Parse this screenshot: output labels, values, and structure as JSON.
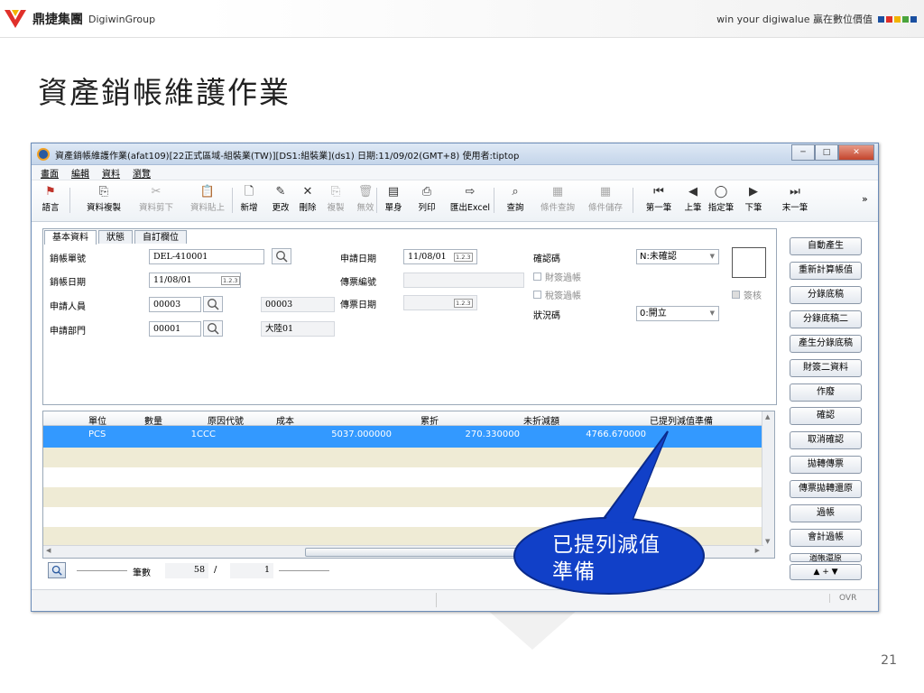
{
  "header": {
    "logo_cn": "鼎捷集團",
    "logo_en": "DigiwinGroup",
    "slogan": "win your digiwalue 贏在數位價值",
    "slogan_colors": [
      "#1a4fa0",
      "#e0302a",
      "#f2b400",
      "#4aa43c",
      "#1a4fa0"
    ]
  },
  "slide_title": "資產銷帳維護作業",
  "page_number": "21",
  "window": {
    "title": "資產銷帳維護作業(afat109)[22正式區域-組裝業(TW)][DS1:組裝業](ds1) 日期:11/09/02(GMT+8) 使用者:tiptop",
    "menu": [
      "畫面",
      "編輯",
      "資料",
      "瀏覽"
    ],
    "toolbar": [
      {
        "label": "語言",
        "icon": "flag-icon",
        "enabled": true
      },
      {
        "label": "資料複製",
        "icon": "copy-icon",
        "enabled": true
      },
      {
        "label": "資料剪下",
        "icon": "cut-icon",
        "enabled": false
      },
      {
        "label": "資料貼上",
        "icon": "paste-icon",
        "enabled": false
      },
      {
        "label": "新增",
        "icon": "new-icon",
        "enabled": true
      },
      {
        "label": "更改",
        "icon": "edit-icon",
        "enabled": true
      },
      {
        "label": "刪除",
        "icon": "delete-icon",
        "enabled": true
      },
      {
        "label": "複製",
        "icon": "duplicate-icon",
        "enabled": false
      },
      {
        "label": "無效",
        "icon": "trash-icon",
        "enabled": false
      },
      {
        "label": "單身",
        "icon": "detail-icon",
        "enabled": true
      },
      {
        "label": "列印",
        "icon": "print-icon",
        "enabled": true
      },
      {
        "label": "匯出Excel",
        "icon": "export-excel-icon",
        "enabled": true
      },
      {
        "label": "查詢",
        "icon": "binoculars-icon",
        "enabled": true
      },
      {
        "label": "條件查詢",
        "icon": "query-condition-icon",
        "enabled": false
      },
      {
        "label": "條件儲存",
        "icon": "save-condition-icon",
        "enabled": false
      },
      {
        "label": "第一筆",
        "icon": "first-record-icon",
        "enabled": true
      },
      {
        "label": "上筆",
        "icon": "previous-record-icon",
        "enabled": true
      },
      {
        "label": "指定筆",
        "icon": "goto-record-icon",
        "enabled": true
      },
      {
        "label": "下筆",
        "icon": "next-record-icon",
        "enabled": true
      },
      {
        "label": "末一筆",
        "icon": "last-record-icon",
        "enabled": true
      }
    ],
    "more": "»"
  },
  "tabs": [
    "基本資料",
    "狀態",
    "自訂欄位"
  ],
  "form": {
    "write_off_no_label": "銷帳單號",
    "write_off_no": "DEL-410001",
    "write_off_date_label": "銷帳日期",
    "write_off_date": "11/08/01",
    "applicant_label": "申請人員",
    "applicant_code": "00003",
    "applicant_name": "00003",
    "dept_label": "申請部門",
    "dept_code": "00001",
    "dept_name": "大陸01",
    "apply_date_label": "申請日期",
    "apply_date": "11/08/01",
    "voucher_no_label": "傳票編號",
    "voucher_no": "",
    "voucher_date_label": "傳票日期",
    "voucher_date": "",
    "confirm_label": "確認碼",
    "confirm_value": "N:未確認",
    "fin_posted_label": "財簽過帳",
    "tax_posted_label": "稅簽過帳",
    "status_label": "狀況碼",
    "status_value": "0:開立",
    "sign_label": "簽核",
    "cal_text": "1.2.3"
  },
  "right_buttons": [
    "自動產生",
    "重新計算帳值",
    "分錄底稿",
    "分錄底稿二",
    "產生分錄底稿",
    "財簽二資料",
    "作廢",
    "確認",
    "取消確認",
    "拋轉傳票",
    "傳票拋轉還原",
    "過帳",
    "會計過帳",
    "過帳還原"
  ],
  "grid": {
    "columns": [
      "單位",
      "數量",
      "原因代號",
      "成本",
      "累折",
      "未折減額",
      "已提列減值準備"
    ],
    "rows": [
      {
        "unit": "PCS",
        "qty": "1",
        "reason": "CCC",
        "cost": "5037.000000",
        "accum_dep": "270.330000",
        "undepreciated": "4766.670000",
        "impairment": ""
      }
    ],
    "row_colors": {
      "selected": "#3399ff",
      "band_alt": "#efebd5",
      "band": "#ffffff"
    }
  },
  "nav": {
    "count_label": "筆數",
    "count": "58",
    "separator": "/",
    "current": "1",
    "updown": "▲ + ▼"
  },
  "status": {
    "ovr": "OVR"
  },
  "callout": {
    "text": "已提列減值準備",
    "fill": "#1140c8",
    "border": "#0a2a8a"
  }
}
